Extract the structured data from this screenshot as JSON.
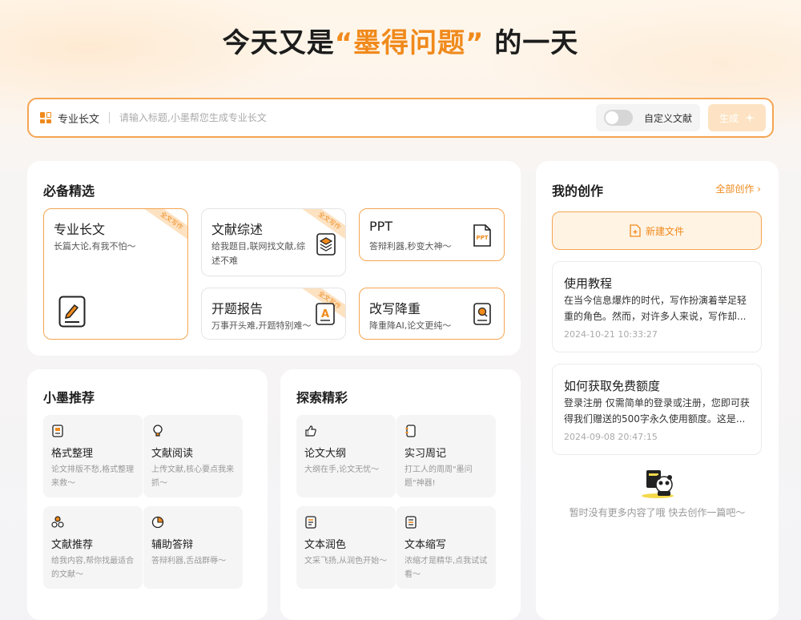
{
  "hero": {
    "prefix": "今天又是",
    "accent": "“墨得问题”",
    "suffix": " 的一天"
  },
  "search": {
    "mode_label": "专业长文",
    "placeholder": "请输入标题,小墨帮您生成专业长文",
    "value": "",
    "custom_doc_label": "自定义文献",
    "custom_doc_enabled": false,
    "generate_label": "生成"
  },
  "essentials": {
    "title": "必备精选",
    "ribbon": "全文写作",
    "cards": [
      {
        "title": "专业长文",
        "desc": "长篇大论,有我不怕～",
        "icon": "pencil-document-icon"
      },
      {
        "title": "文献综述",
        "desc": "给我题目,联网找文献,综述不难",
        "icon": "layers-icon"
      },
      {
        "title": "PPT",
        "desc": "答辩利器,秒变大神～",
        "icon": "ppt-file-icon",
        "icon_text": "PPT"
      },
      {
        "title": "开题报告",
        "desc": "万事开头难,开题特别难～",
        "icon": "letter-a-document-icon",
        "icon_text": "A"
      },
      {
        "title": "改写降重",
        "desc": "降重降AI,论文更纯～",
        "icon": "search-document-icon"
      }
    ]
  },
  "recommend": {
    "title": "小墨推荐",
    "items": [
      {
        "title": "格式整理",
        "desc": "论文排版不愁,格式整理来救～",
        "icon": "format-icon"
      },
      {
        "title": "文献阅读",
        "desc": "上传文献,核心要点我来抓～",
        "icon": "lightbulb-icon"
      },
      {
        "title": "文献推荐",
        "desc": "给我内容,帮你找最适合的文献～",
        "icon": "circles-icon"
      },
      {
        "title": "辅助答辩",
        "desc": "答辩利器,舌战群辱～",
        "icon": "pie-chart-icon"
      }
    ]
  },
  "explore": {
    "title": "探索精彩",
    "items": [
      {
        "title": "论文大纲",
        "desc": "大纲在手,论文无忧～",
        "icon": "thumbs-up-icon"
      },
      {
        "title": "实习周记",
        "desc": "打工人的周周\"墨问题\"神器!",
        "icon": "notebook-icon"
      },
      {
        "title": "文本润色",
        "desc": "文采飞扬,从润色开始～",
        "icon": "text-lines-icon"
      },
      {
        "title": "文本缩写",
        "desc": "浓缩才是精华,点我试试看～",
        "icon": "document-lines-icon"
      }
    ]
  },
  "works": {
    "title": "我的创作",
    "all_label": "全部创作",
    "new_file_label": "新建文件",
    "items": [
      {
        "title": "使用教程",
        "excerpt": "在当今信息爆炸的时代，写作扮演着举足轻重的角色。然而，对许多人来说，写作却...",
        "date": "2024-10-21 10:33:27"
      },
      {
        "title": "如何获取免费额度",
        "excerpt": "登录注册 仅需简单的登录或注册，您即可获得我们赠送的500字永久使用额度。这是...",
        "date": "2024-09-08 20:47:15"
      }
    ],
    "empty_tip": "暂时没有更多内容了哦 快去创作一篇吧～"
  },
  "colors": {
    "accent": "#f08a1c",
    "accent_border": "#f5a552",
    "accent_light": "#fff3e4"
  }
}
